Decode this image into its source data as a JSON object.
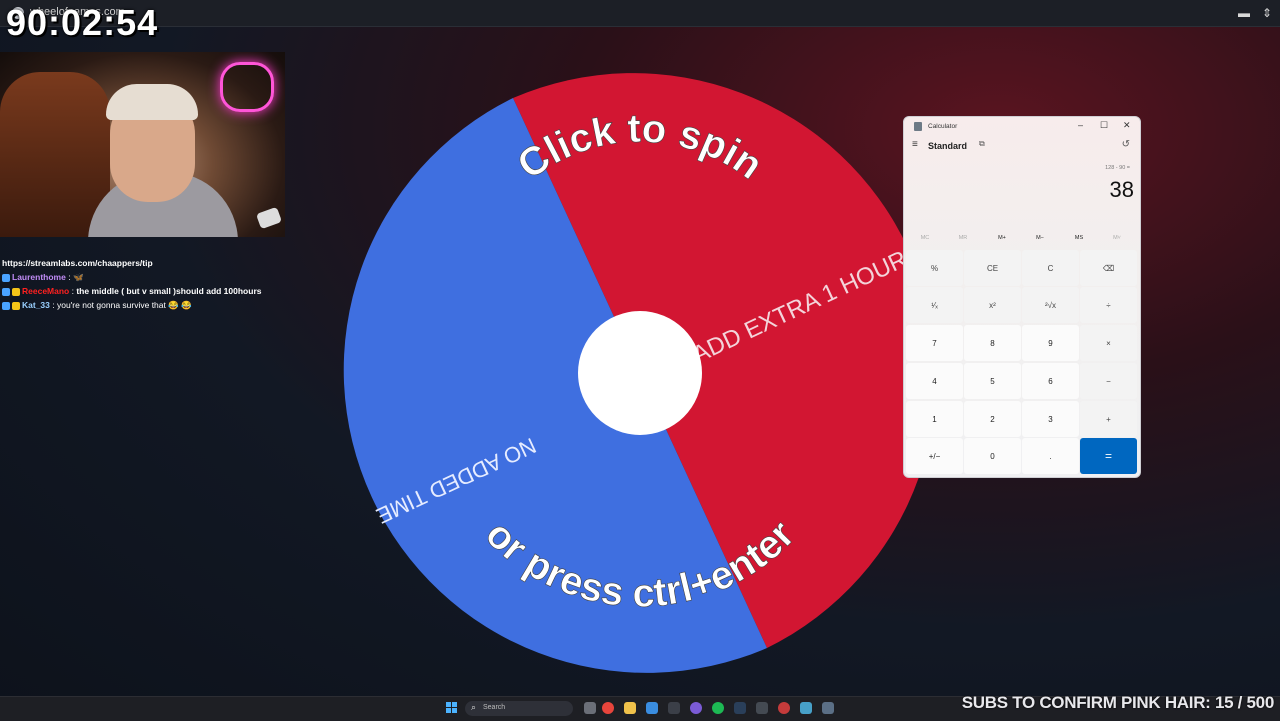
{
  "browser": {
    "url": "wheelofnames.com"
  },
  "timer": "90:02:54",
  "chat": {
    "tip_link": "https://streamlabs.com/chaappers/tip",
    "messages": [
      {
        "user": "Laurenthome",
        "sep": " : ",
        "text": "🦋",
        "user_color": "#c18cf7"
      },
      {
        "user": "ReeceMano",
        "sep": " : ",
        "text": "the middle ( but v small )should add 100hours",
        "user_color": "#ff2020"
      },
      {
        "user": "Kat_33",
        "sep": " : ",
        "text": "you're not gonna survive that 😂 😂",
        "user_color": "#9ad0ff"
      }
    ]
  },
  "wheel": {
    "top_text": "Click to spin",
    "bottom_text": "or press ctrl+enter",
    "segments": [
      {
        "label": "ADD EXTRA 1 HOUR",
        "color": "#d21632",
        "fraction": 0.5
      },
      {
        "label": "NO ADDED TIME",
        "color": "#3f6fe0",
        "fraction": 0.5
      }
    ]
  },
  "calculator": {
    "window_title": "Calculator",
    "mode": "Standard",
    "expression": "128 - 90 =",
    "display": "38",
    "memory": [
      "MC",
      "MR",
      "M+",
      "M−",
      "MS",
      "M˅"
    ],
    "keys": [
      [
        "%",
        "CE",
        "C",
        "⌫"
      ],
      [
        "¹⁄ₓ",
        "x²",
        "²√x",
        "÷"
      ],
      [
        "7",
        "8",
        "9",
        "×"
      ],
      [
        "4",
        "5",
        "6",
        "−"
      ],
      [
        "1",
        "2",
        "3",
        "+"
      ],
      [
        "+/−",
        "0",
        ".",
        "="
      ]
    ]
  },
  "taskbar": {
    "search_placeholder": "Search"
  },
  "subs_overlay": "SUBS TO CONFIRM PINK HAIR: 15 / 500"
}
